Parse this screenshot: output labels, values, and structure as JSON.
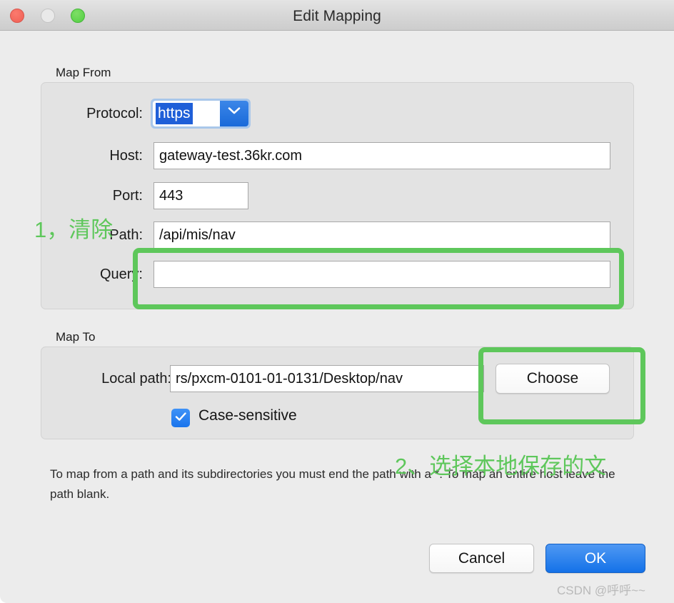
{
  "window": {
    "title": "Edit Mapping",
    "traffic_lights": {
      "close": "close-button",
      "minimize": "minimize-button",
      "zoom": "zoom-button"
    }
  },
  "map_from": {
    "group_label": "Map From",
    "fields": {
      "protocol": {
        "label": "Protocol:",
        "value": "https",
        "selected": true
      },
      "host": {
        "label": "Host:",
        "value": "gateway-test.36kr.com"
      },
      "port": {
        "label": "Port:",
        "value": "443"
      },
      "path": {
        "label": "Path:",
        "value": "/api/mis/nav"
      },
      "query": {
        "label": "Query:",
        "value": ""
      }
    }
  },
  "map_to": {
    "group_label": "Map To",
    "local_path": {
      "label": "Local path:",
      "value": "rs/pxcm-0101-01-0131/Desktop/nav"
    },
    "choose_button": "Choose",
    "case_sensitive": {
      "label": "Case-sensitive",
      "checked": true
    }
  },
  "help_text": "To map from a path and its subdirectories you must end the path with a *. To map an entire host leave the path blank.",
  "footer": {
    "cancel_label": "Cancel",
    "ok_label": "OK"
  },
  "annotations": {
    "accent_color": "#5ec75b",
    "step1_text": "1，清除",
    "step2_text": "2、选择本地保存的文"
  },
  "watermark": "CSDN @呼呼~~"
}
